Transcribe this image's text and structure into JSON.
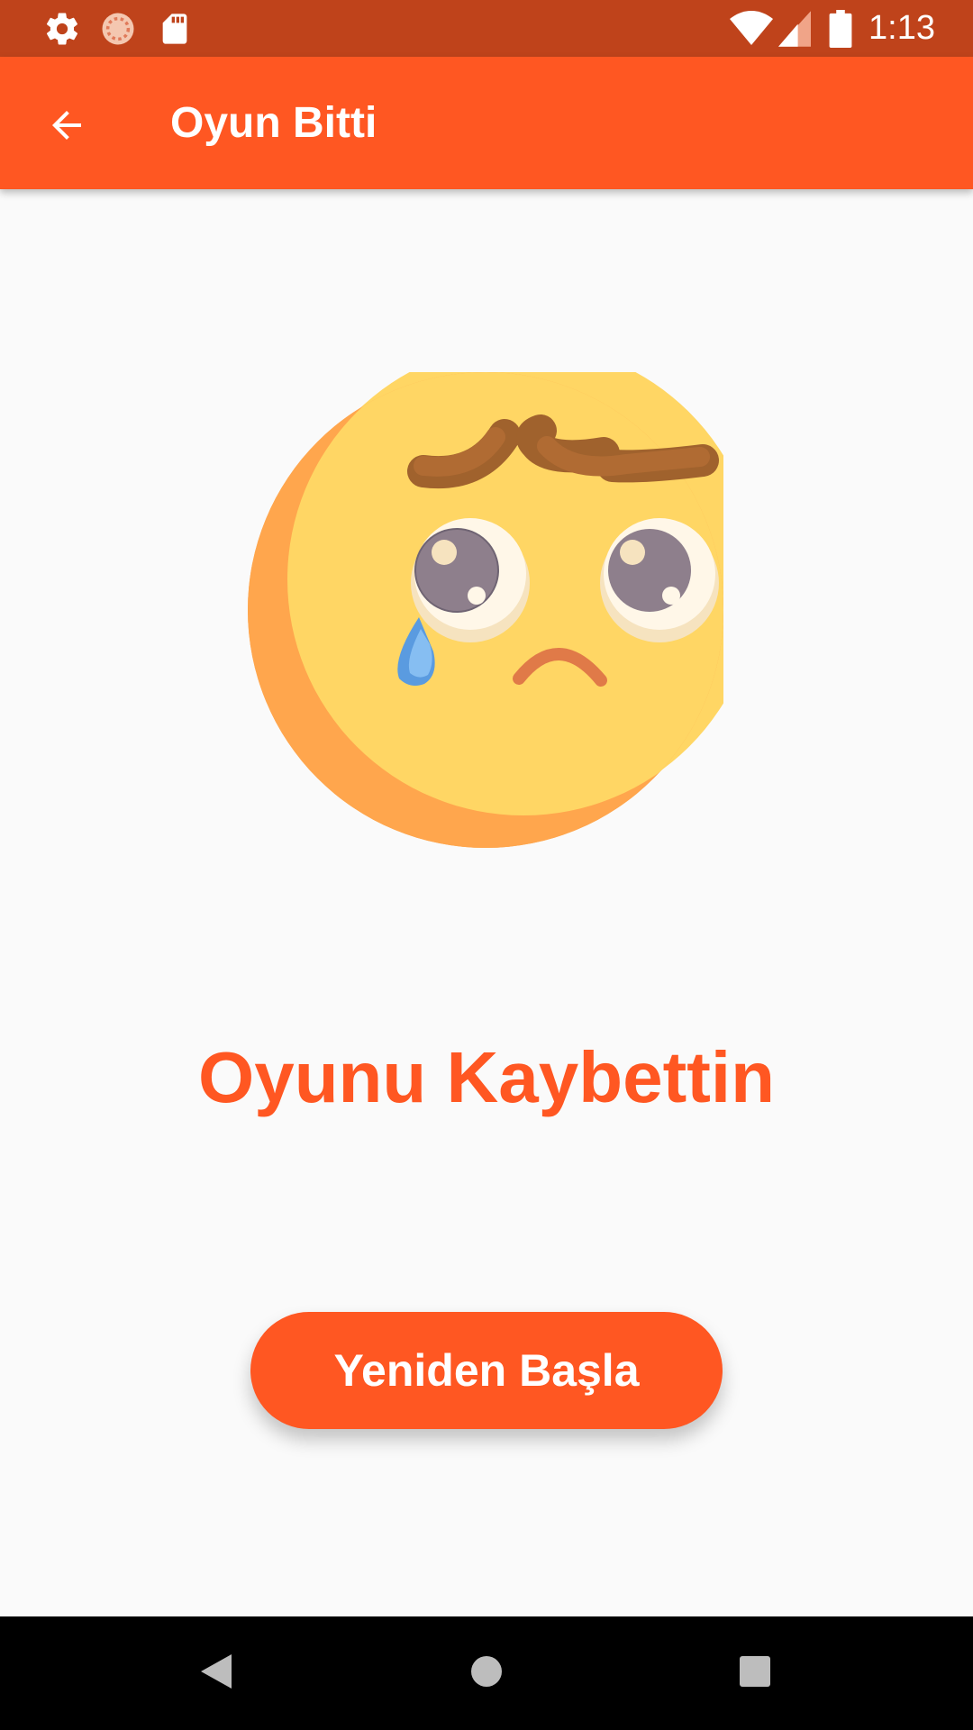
{
  "status_bar": {
    "time": "1:13",
    "left_icons": [
      "gear-icon",
      "sync-icon",
      "sd-card-icon"
    ],
    "right_icons": [
      "wifi-icon",
      "signal-icon",
      "battery-icon"
    ]
  },
  "app_bar": {
    "title": "Oyun Bitti",
    "back_icon": "arrow-back-icon"
  },
  "main": {
    "illustration": "crying-face-emoji",
    "result_text": "Oyunu Kaybettin",
    "restart_label": "Yeniden Başla"
  },
  "nav_bar": {
    "icons": [
      "back-triangle-icon",
      "home-circle-icon",
      "recents-square-icon"
    ]
  },
  "colors": {
    "status_bar": "#BF431B",
    "accent": "#FF5722",
    "background": "#FAFAFA",
    "nav_bar": "#000000"
  }
}
